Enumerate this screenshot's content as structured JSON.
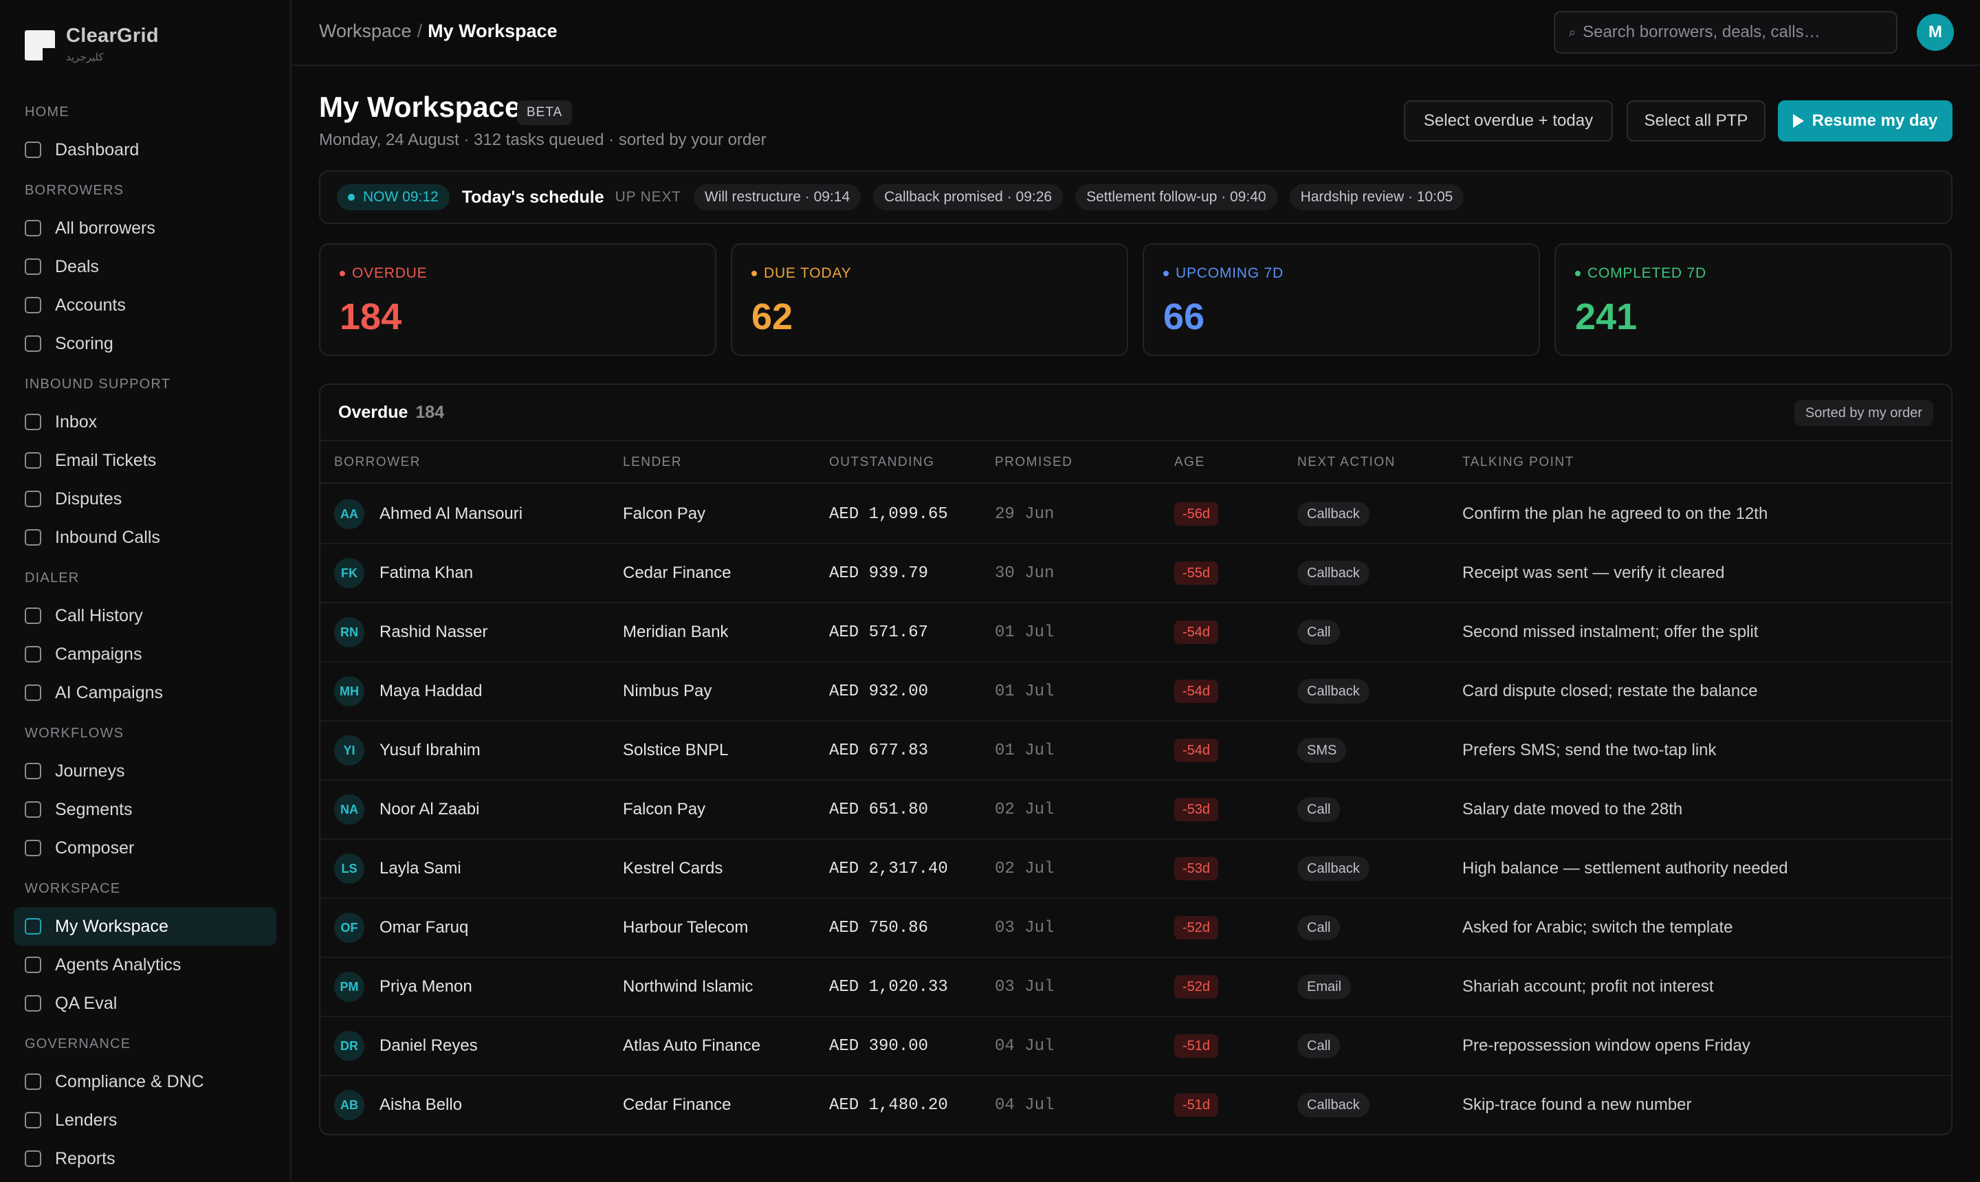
{
  "app": {
    "brand_name": "ClearGrid",
    "brand_sub": "كليرجريد"
  },
  "sidebar": {
    "sections": [
      {
        "title": "HOME",
        "items": [
          {
            "label": "Dashboard",
            "active": false
          }
        ]
      },
      {
        "title": "BORROWERS",
        "items": [
          {
            "label": "All borrowers",
            "active": false
          },
          {
            "label": "Deals",
            "active": false
          },
          {
            "label": "Accounts",
            "active": false
          },
          {
            "label": "Scoring",
            "active": false
          }
        ]
      },
      {
        "title": "INBOUND SUPPORT",
        "items": [
          {
            "label": "Inbox",
            "active": false
          },
          {
            "label": "Email Tickets",
            "active": false
          },
          {
            "label": "Disputes",
            "active": false
          },
          {
            "label": "Inbound Calls",
            "active": false
          }
        ]
      },
      {
        "title": "DIALER",
        "items": [
          {
            "label": "Call History",
            "active": false
          },
          {
            "label": "Campaigns",
            "active": false
          },
          {
            "label": "AI Campaigns",
            "active": false
          }
        ]
      },
      {
        "title": "WORKFLOWS",
        "items": [
          {
            "label": "Journeys",
            "active": false
          },
          {
            "label": "Segments",
            "active": false
          },
          {
            "label": "Composer",
            "active": false
          }
        ]
      },
      {
        "title": "WORKSPACE",
        "items": [
          {
            "label": "My Workspace",
            "active": true
          },
          {
            "label": "Agents Analytics",
            "active": false
          },
          {
            "label": "QA Eval",
            "active": false
          }
        ]
      },
      {
        "title": "GOVERNANCE",
        "items": [
          {
            "label": "Compliance & DNC",
            "active": false
          },
          {
            "label": "Lenders",
            "active": false
          },
          {
            "label": "Reports",
            "active": false
          }
        ]
      }
    ]
  },
  "topbar": {
    "breadcrumb_root": "Workspace",
    "breadcrumb_sep": "/",
    "breadcrumb_current": "My Workspace",
    "search_placeholder": "Search borrowers, deals, calls…",
    "search_icon": "⌕",
    "avatar_initial": "M"
  },
  "header": {
    "title": "My Workspace",
    "badge": "BETA",
    "subtitle": "Monday, 24 August · 312 tasks queued · sorted by your order",
    "btn_overdue_today": "Select overdue + today",
    "btn_select_ptp": "Select all PTP",
    "btn_resume": "Resume my day"
  },
  "schedule": {
    "now_label": "NOW 09:12",
    "title": "Today's schedule",
    "up_next_label": "UP NEXT",
    "chips": [
      "Will restructure · 09:14",
      "Callback promised · 09:26",
      "Settlement follow-up · 09:40",
      "Hardship review · 10:05"
    ]
  },
  "stats": [
    {
      "label": "OVERDUE",
      "value": "184",
      "color": "#f0594f"
    },
    {
      "label": "DUE TODAY",
      "value": "62",
      "color": "#f2a33a"
    },
    {
      "label": "UPCOMING 7D",
      "value": "66",
      "color": "#5b8ff5"
    },
    {
      "label": "COMPLETED 7D",
      "value": "241",
      "color": "#3ec57a"
    }
  ],
  "table": {
    "title": "Overdue",
    "count": "184",
    "sorted_label": "Sorted by my order",
    "columns": [
      "BORROWER",
      "LENDER",
      "OUTSTANDING",
      "PROMISED",
      "AGE",
      "NEXT ACTION",
      "TALKING POINT"
    ],
    "rows": [
      {
        "initials": "AA",
        "borrower": "Ahmed Al Mansouri",
        "lender": "Falcon Pay",
        "outstanding": "AED 1,099.65",
        "promised": "29 Jun",
        "age": "-56d",
        "action": "Callback",
        "talking_point": "Confirm the plan he agreed to on the 12th"
      },
      {
        "initials": "FK",
        "borrower": "Fatima Khan",
        "lender": "Cedar Finance",
        "outstanding": "AED 939.79",
        "promised": "30 Jun",
        "age": "-55d",
        "action": "Callback",
        "talking_point": "Receipt was sent — verify it cleared"
      },
      {
        "initials": "RN",
        "borrower": "Rashid Nasser",
        "lender": "Meridian Bank",
        "outstanding": "AED 571.67",
        "promised": "01 Jul",
        "age": "-54d",
        "action": "Call",
        "talking_point": "Second missed instalment; offer the split"
      },
      {
        "initials": "MH",
        "borrower": "Maya Haddad",
        "lender": "Nimbus Pay",
        "outstanding": "AED 932.00",
        "promised": "01 Jul",
        "age": "-54d",
        "action": "Callback",
        "talking_point": "Card dispute closed; restate the balance"
      },
      {
        "initials": "YI",
        "borrower": "Yusuf Ibrahim",
        "lender": "Solstice BNPL",
        "outstanding": "AED 677.83",
        "promised": "01 Jul",
        "age": "-54d",
        "action": "SMS",
        "talking_point": "Prefers SMS; send the two-tap link"
      },
      {
        "initials": "NA",
        "borrower": "Noor Al Zaabi",
        "lender": "Falcon Pay",
        "outstanding": "AED 651.80",
        "promised": "02 Jul",
        "age": "-53d",
        "action": "Call",
        "talking_point": "Salary date moved to the 28th"
      },
      {
        "initials": "LS",
        "borrower": "Layla Sami",
        "lender": "Kestrel Cards",
        "outstanding": "AED 2,317.40",
        "promised": "02 Jul",
        "age": "-53d",
        "action": "Callback",
        "talking_point": "High balance — settlement authority needed"
      },
      {
        "initials": "OF",
        "borrower": "Omar Faruq",
        "lender": "Harbour Telecom",
        "outstanding": "AED 750.86",
        "promised": "03 Jul",
        "age": "-52d",
        "action": "Call",
        "talking_point": "Asked for Arabic; switch the template"
      },
      {
        "initials": "PM",
        "borrower": "Priya Menon",
        "lender": "Northwind Islamic",
        "outstanding": "AED 1,020.33",
        "promised": "03 Jul",
        "age": "-52d",
        "action": "Email",
        "talking_point": "Shariah account; profit not interest"
      },
      {
        "initials": "DR",
        "borrower": "Daniel Reyes",
        "lender": "Atlas Auto Finance",
        "outstanding": "AED 390.00",
        "promised": "04 Jul",
        "age": "-51d",
        "action": "Call",
        "talking_point": "Pre-repossession window opens Friday"
      },
      {
        "initials": "AB",
        "borrower": "Aisha Bello",
        "lender": "Cedar Finance",
        "outstanding": "AED 1,480.20",
        "promised": "04 Jul",
        "age": "-51d",
        "action": "Callback",
        "talking_point": "Skip-trace found a new number"
      }
    ]
  }
}
